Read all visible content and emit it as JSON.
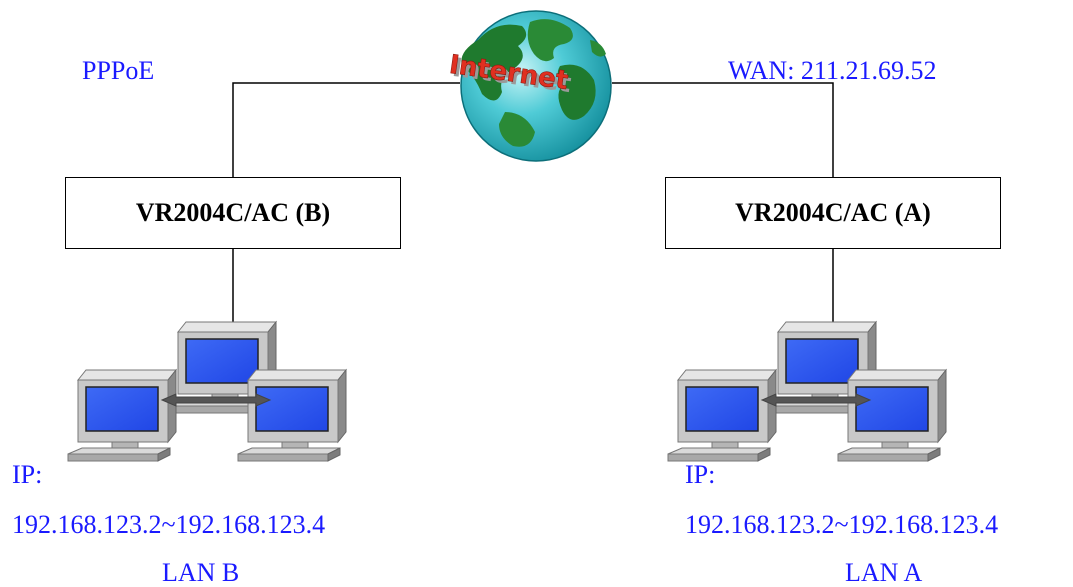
{
  "internet_label": "Internet",
  "left_connection": "PPPoE",
  "right_connection": "WAN: 211.21.69.52",
  "router_b": "VR2004C/AC (B)",
  "router_a": "VR2004C/AC (A)",
  "lan_b": {
    "ip_label": "IP:",
    "ip_range": "192.168.123.2~192.168.123.4",
    "name": "LAN B"
  },
  "lan_a": {
    "ip_label": "IP:",
    "ip_range": "192.168.123.2~192.168.123.4",
    "name": "LAN A"
  },
  "colors": {
    "label_text": "#1a1aff",
    "monitor_screen": "#2e5bf0",
    "globe_ocean": "#2ab5c2",
    "globe_land": "#1f7a2e",
    "internet_text": "#e03020"
  }
}
